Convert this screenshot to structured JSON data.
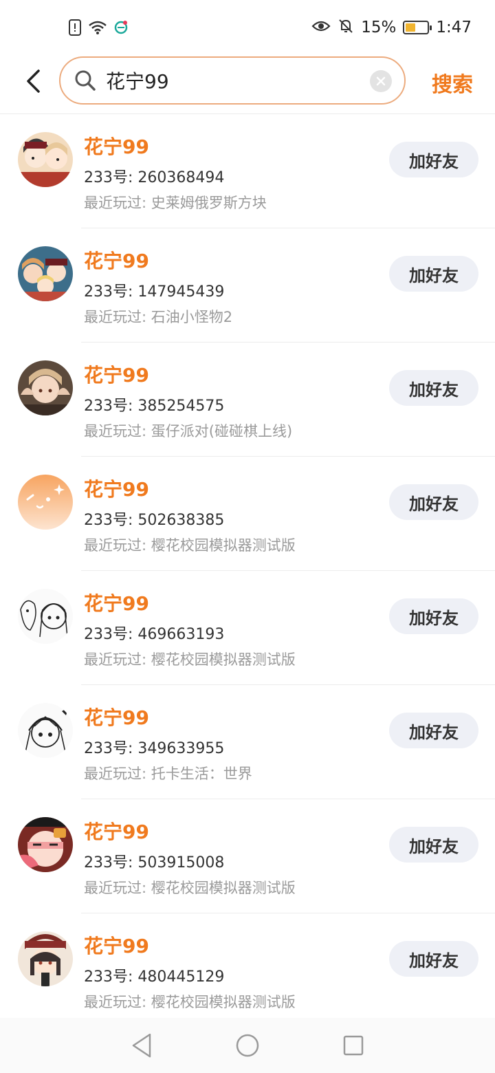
{
  "status_bar": {
    "battery_percent": "15%",
    "time": "1:47",
    "left_icons": [
      "sim-alert-icon",
      "wifi-icon",
      "app-notification-icon"
    ],
    "right_icons": [
      "eye-comfort-icon",
      "silent-bell-icon"
    ],
    "battery_level": 0.15,
    "battery_color": "#f0b430"
  },
  "header": {
    "back_icon": "chevron-left-icon",
    "search_icon": "search-icon",
    "search_value": "花宁99",
    "clear_icon": "close-icon",
    "search_button_label": "搜索",
    "accent_color": "#f07a1e",
    "search_border_color": "#ecab7e"
  },
  "results": [
    {
      "name": "花宁99",
      "id_line": "233号: 260368494",
      "recent": "最近玩过: 史莱姆俄罗斯方块",
      "button": "加好友",
      "avatar": "anime-avatar-icon"
    },
    {
      "name": "花宁99",
      "id_line": "233号: 147945439",
      "recent": "最近玩过: 石油小怪物2",
      "button": "加好友",
      "avatar": "anime-avatar-icon"
    },
    {
      "name": "花宁99",
      "id_line": "233号: 385254575",
      "recent": "最近玩过: 蛋仔派对(碰碰棋上线)",
      "button": "加好友",
      "avatar": "anime-avatar-icon"
    },
    {
      "name": "花宁99",
      "id_line": "233号: 502638385",
      "recent": "最近玩过: 樱花校园模拟器测试版",
      "button": "加好友",
      "avatar": "default-avatar-icon"
    },
    {
      "name": "花宁99",
      "id_line": "233号: 469663193",
      "recent": "最近玩过: 樱花校园模拟器测试版",
      "button": "加好友",
      "avatar": "sketch-avatar-icon"
    },
    {
      "name": "花宁99",
      "id_line": "233号: 349633955",
      "recent": "最近玩过: 托卡生活：世界",
      "button": "加好友",
      "avatar": "sketch-avatar-icon"
    },
    {
      "name": "花宁99",
      "id_line": "233号: 503915008",
      "recent": "最近玩过: 樱花校园模拟器测试版",
      "button": "加好友",
      "avatar": "anime-avatar-icon"
    },
    {
      "name": "花宁99",
      "id_line": "233号: 480445129",
      "recent": "最近玩过: 樱花校园模拟器测试版",
      "button": "加好友",
      "avatar": "anime-avatar-icon"
    }
  ],
  "nav_bar": {
    "back_icon": "nav-back-triangle-icon",
    "home_icon": "nav-home-circle-icon",
    "recents_icon": "nav-recents-square-icon"
  }
}
